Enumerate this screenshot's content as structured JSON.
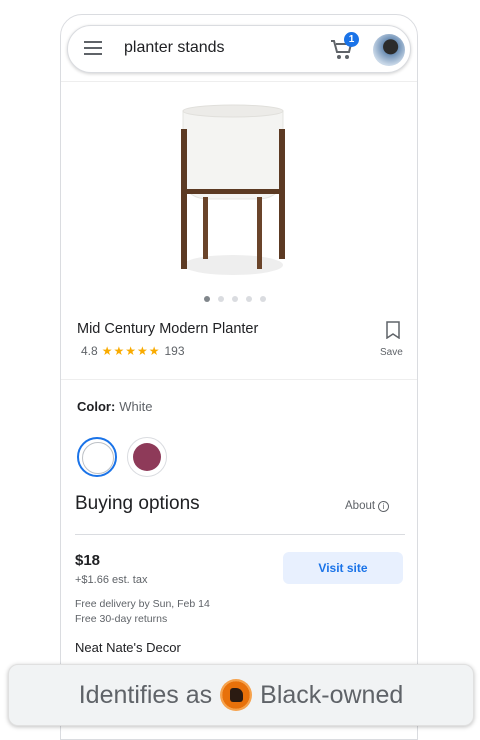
{
  "search": {
    "query": "planter stands"
  },
  "cart": {
    "count": "1"
  },
  "product": {
    "title": "Mid Century Modern Planter",
    "rating": "4.8",
    "stars": "★★★★★",
    "review_count": "193",
    "save_label": "Save",
    "image_dots": 5,
    "active_dot": 0
  },
  "color": {
    "label": "Color:",
    "value": "White",
    "options": [
      {
        "name": "white",
        "hex": "#ffffff"
      },
      {
        "name": "plum",
        "hex": "#8e3a59"
      }
    ]
  },
  "buying": {
    "title": "Buying options",
    "about_label": "About",
    "info_glyph": "i",
    "price": "$18",
    "tax": "+$1.66 est. tax",
    "visit_label": "Visit site",
    "delivery": "Free delivery by Sun, Feb 14",
    "returns": "Free 30-day returns",
    "seller": "Neat Nate's Decor"
  },
  "badge": {
    "before": "Identifies as",
    "after": "Black-owned",
    "icon": "black-owned-icon"
  },
  "colors": {
    "accent": "#1a73e8",
    "star": "#f9ab00",
    "swatch_plum": "#8e3a59",
    "badge_orange": "#e8710a"
  }
}
